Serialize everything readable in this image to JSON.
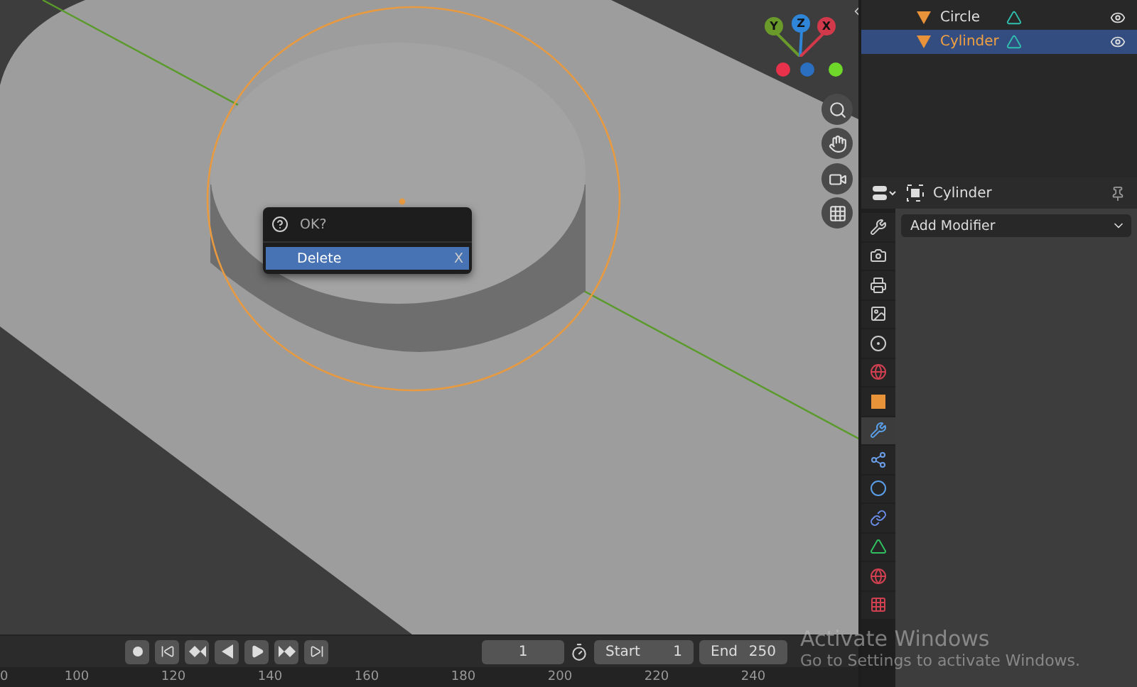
{
  "viewport": {
    "gizmo_axes": [
      {
        "label": "Y",
        "color": "#6a9a2a"
      },
      {
        "label": "Z",
        "color": "#2f86d8"
      },
      {
        "label": "X",
        "color": "#d2394b"
      }
    ],
    "popup": {
      "title": "OK?",
      "items": [
        {
          "label": "Delete",
          "shortcut": "X",
          "selected": true
        }
      ]
    }
  },
  "outliner": {
    "items": [
      {
        "name": "Circle",
        "selected": false
      },
      {
        "name": "Cylinder",
        "selected": true
      }
    ]
  },
  "properties": {
    "object_name": "Cylinder",
    "add_modifier": "Add Modifier",
    "tabs": [
      {
        "kind": "tool",
        "selected": false
      },
      {
        "kind": "render",
        "selected": false
      },
      {
        "kind": "output",
        "selected": false
      },
      {
        "kind": "view",
        "selected": false
      },
      {
        "kind": "scene",
        "selected": false
      },
      {
        "kind": "world",
        "selected": false
      },
      {
        "kind": "object",
        "selected": false
      },
      {
        "kind": "modifier",
        "selected": true
      },
      {
        "kind": "particles",
        "selected": false
      },
      {
        "kind": "physics",
        "selected": false
      },
      {
        "kind": "constraints",
        "selected": false
      },
      {
        "kind": "data",
        "selected": false
      },
      {
        "kind": "material",
        "selected": false
      },
      {
        "kind": "texture",
        "selected": false
      }
    ]
  },
  "timeline": {
    "current_frame": "1",
    "start_label": "Start",
    "start": "1",
    "end_label": "End",
    "end": "250",
    "ruler": [
      "0",
      "100",
      "120",
      "140",
      "160",
      "180",
      "200",
      "220",
      "240"
    ]
  },
  "os_notice": {
    "title": "Activate Windows",
    "text": "Go to Settings to activate Windows."
  }
}
